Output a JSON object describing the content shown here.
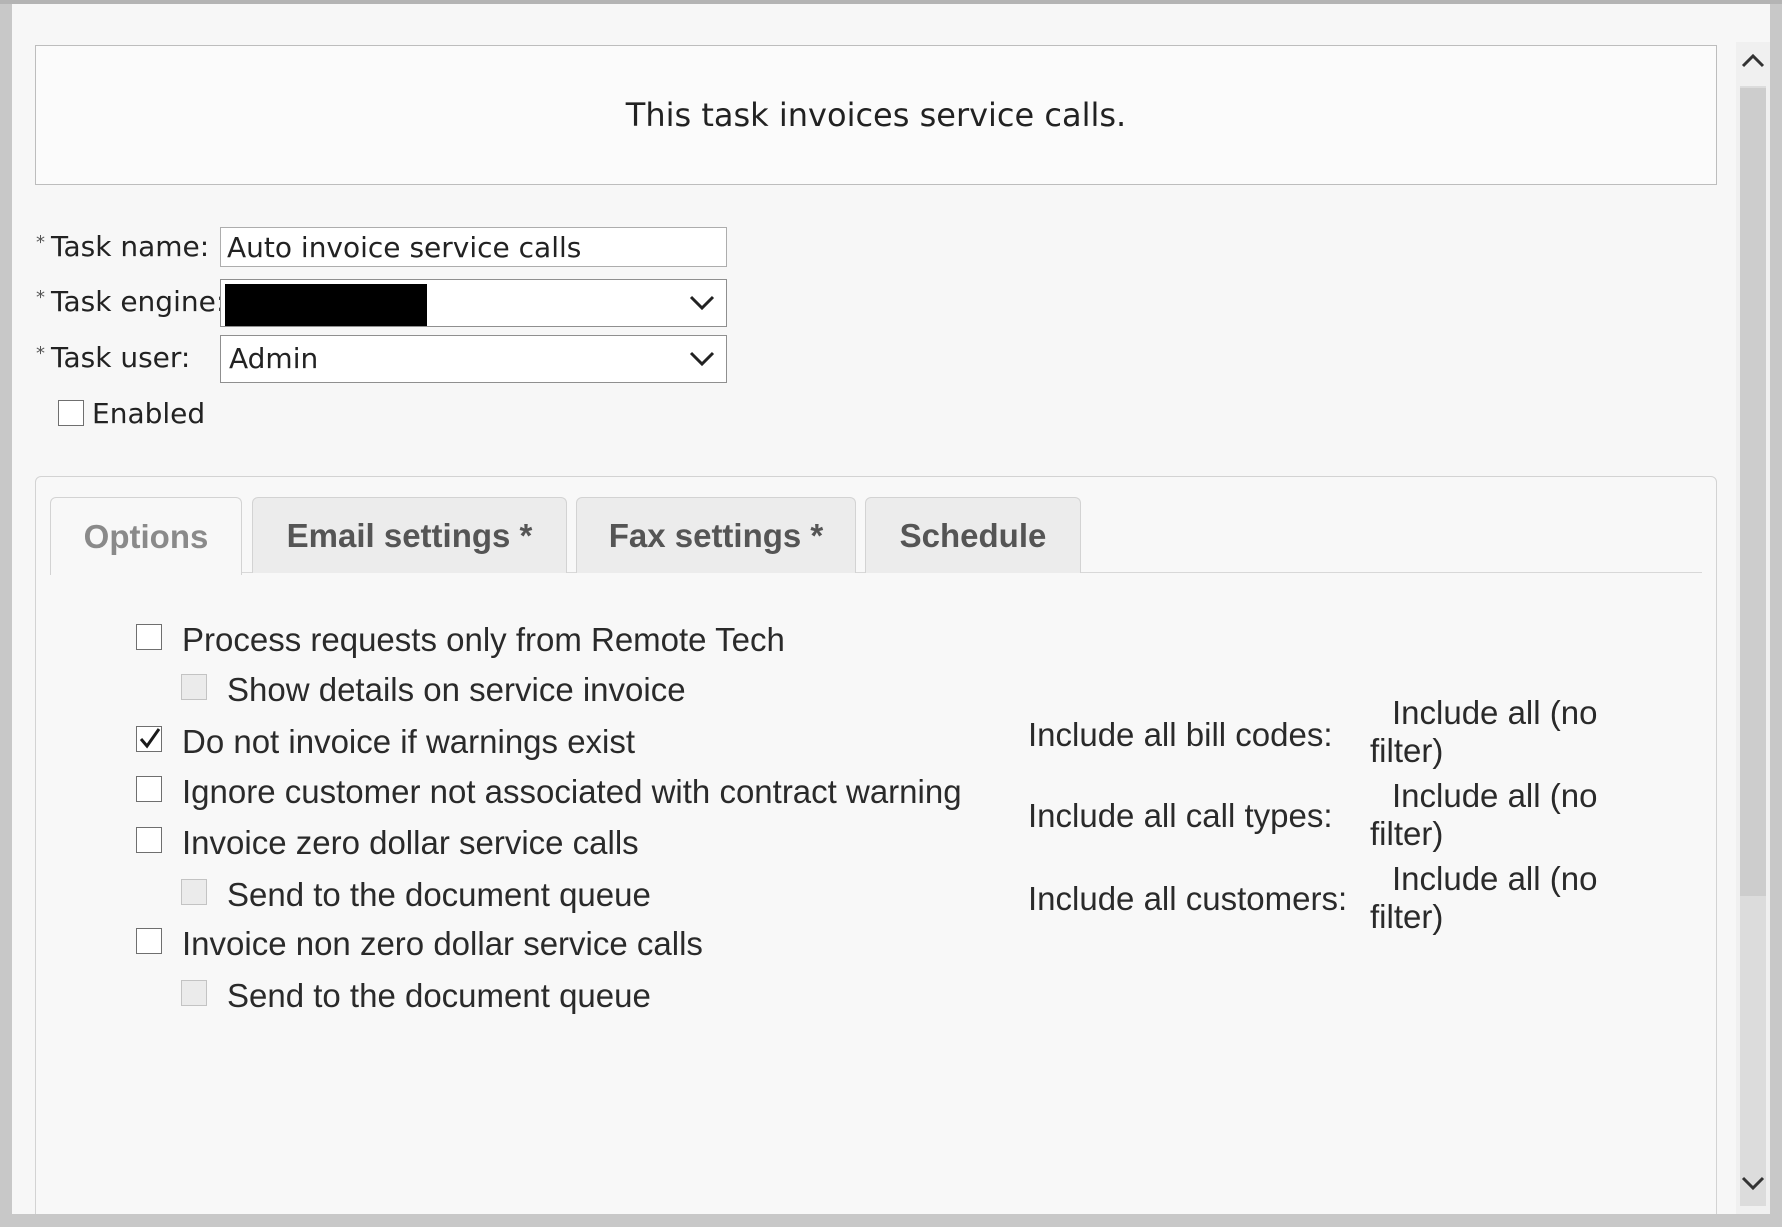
{
  "description": "This task invoices service calls.",
  "form": {
    "task_name_label": "Task name:",
    "task_name_value": "Auto invoice service calls",
    "task_engine_label": "Task engine:",
    "task_user_label": "Task user:",
    "task_user_value": "Admin",
    "required_marker": "*",
    "enabled_label": "Enabled",
    "enabled_checked": false
  },
  "tabs": [
    {
      "label": "Options",
      "active": true
    },
    {
      "label": "Email settings *",
      "active": false
    },
    {
      "label": "Fax settings *",
      "active": false
    },
    {
      "label": "Schedule",
      "active": false
    }
  ],
  "options": [
    {
      "label": "Process requests only from Remote Tech",
      "checked": false,
      "disabled": false
    },
    {
      "label": "Show details on service invoice",
      "checked": false,
      "disabled": true
    },
    {
      "label": "Do not invoice if warnings exist",
      "checked": true,
      "disabled": false
    },
    {
      "label": "Ignore customer not associated with contract warning",
      "checked": false,
      "disabled": false
    },
    {
      "label": "Invoice zero dollar service calls",
      "checked": false,
      "disabled": false
    },
    {
      "label": "Send to the document queue",
      "checked": false,
      "disabled": true
    },
    {
      "label": "Invoice non zero dollar service calls",
      "checked": false,
      "disabled": false
    },
    {
      "label": "Send to the document queue",
      "checked": false,
      "disabled": true
    }
  ],
  "filters": [
    {
      "label": "Include all bill codes:",
      "value": "Include all (no filter)"
    },
    {
      "label": "Include all call types:",
      "value": "Include all (no filter)"
    },
    {
      "label": "Include all customers:",
      "value": "Include all (no filter)"
    }
  ],
  "icons": {
    "dropdown": "chevron-down-icon",
    "scroll_up": "chevron-up-icon",
    "scroll_down": "chevron-down-icon",
    "check": "checkmark-icon"
  }
}
